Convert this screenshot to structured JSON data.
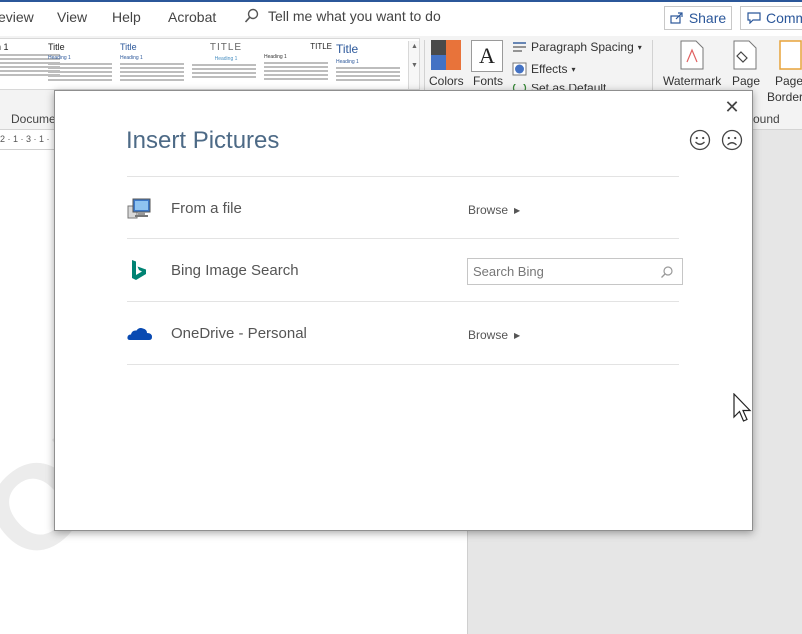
{
  "menubar": {
    "tabs": [
      "eview",
      "View",
      "Help",
      "Acrobat"
    ],
    "tell_me": "Tell me what you want to do",
    "share_label": "Share",
    "comments_label": "Comm"
  },
  "ribbon": {
    "style_gallery": [
      {
        "title": "n 1"
      },
      {
        "title": "Title"
      },
      {
        "title": "Title"
      },
      {
        "title": "TITLE"
      },
      {
        "title": "TITLE"
      },
      {
        "title": "Title"
      }
    ],
    "colors_label": "Colors",
    "fonts_label": "Fonts",
    "fonts_glyph": "A",
    "paragraph_spacing_label": "Paragraph Spacing",
    "effects_label": "Effects",
    "set_default_label": "Set as Default",
    "watermark_label": "Watermark",
    "page_color_label": "Page",
    "page_borders_label": "Page",
    "page_borders_label2": "Borders",
    "group_document_label": "Docume",
    "group_background_label": "ound",
    "theme_colors": [
      "#2b579a",
      "#4a4a4a",
      "#e8733a",
      "#4472c4"
    ]
  },
  "ruler": {
    "text": "2 · 1 · 3 · 1 ·"
  },
  "document": {
    "watermark_text": "ON"
  },
  "dialog": {
    "title": "Insert Pictures",
    "close_glyph": "✕",
    "rows": [
      {
        "label": "From a file",
        "action": "Browse",
        "icon": "computer-icon"
      },
      {
        "label": "Bing Image Search",
        "search_placeholder": "Search Bing",
        "icon": "bing-logo-icon"
      },
      {
        "label": "OneDrive - Personal",
        "action": "Browse",
        "icon": "onedrive-cloud-icon"
      }
    ],
    "colors": {
      "title": "#4d6a86",
      "bing": "#008373",
      "onedrive": "#094ab2"
    }
  }
}
